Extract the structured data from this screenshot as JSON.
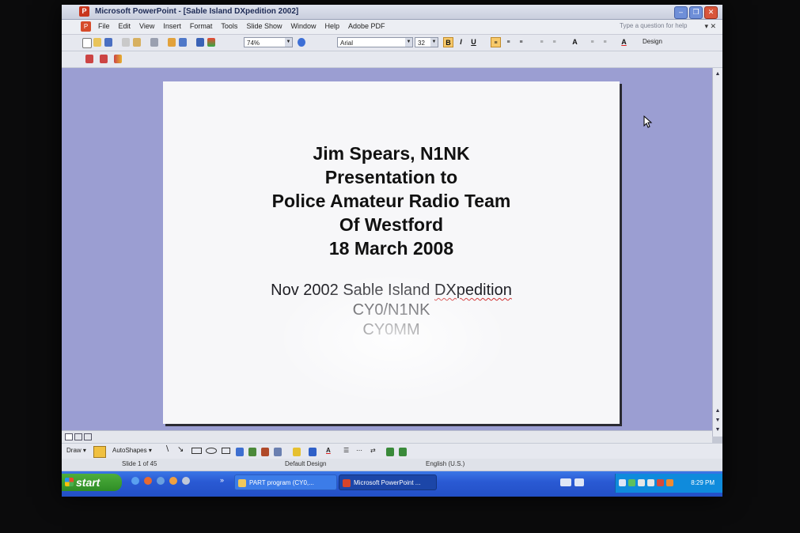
{
  "window": {
    "title": "Microsoft PowerPoint - [Sable Island DXpedition 2002]"
  },
  "menu": {
    "items": [
      "File",
      "Edit",
      "View",
      "Insert",
      "Format",
      "Tools",
      "Slide Show",
      "Window",
      "Help",
      "Adobe PDF"
    ],
    "help_placeholder": "Type a question for help"
  },
  "toolbar": {
    "zoom": "74%",
    "font": "Arial",
    "font_size": "32",
    "bold": "B",
    "italic": "I",
    "underline": "U",
    "grow_font": "A",
    "font_color": "A",
    "design": "Design"
  },
  "slide": {
    "line1": "Jim Spears, N1NK",
    "line2": "Presentation to",
    "line3": "Police Amateur Radio Team",
    "line4": "Of Westford",
    "line5": "18 March 2008",
    "line6a": "Nov 2002 Sable Island ",
    "line6b": "DXpedition",
    "line7": "CY0/N1NK",
    "line8": "CY0MM"
  },
  "drawing_toolbar": {
    "draw": "Draw",
    "autoshapes": "AutoShapes"
  },
  "status": {
    "slide_info": "Slide 1 of 45",
    "design": "Default Design",
    "language": "English (U.S.)"
  },
  "taskbar": {
    "start": "start",
    "item1": "PART program (CY0,...",
    "item2": "Microsoft PowerPoint ...",
    "clock": "8:29 PM"
  }
}
